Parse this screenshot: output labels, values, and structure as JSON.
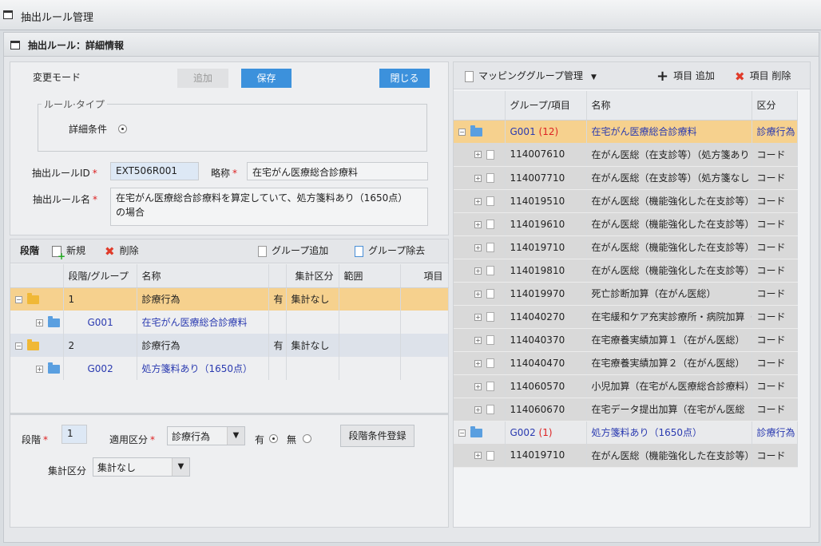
{
  "window": {
    "title": "抽出ルール管理"
  },
  "panel": {
    "title": "抽出ルール：詳細情報"
  },
  "form": {
    "mode_label": "変更モード",
    "add_label": "追加",
    "save_label": "保存",
    "close_label": "閉じる",
    "rule_type_legend": "ルール·タイプ",
    "detail_condition_label": "詳細条件",
    "rule_id_label": "抽出ルールID",
    "rule_id_value": "EXT506R001",
    "abbrev_label": "略称",
    "abbrev_value": "在宅がん医療総合診療料",
    "rule_name_label": "抽出ルール名",
    "rule_name_value": "在宅がん医療総合診療料を算定していて、処方箋料あり（1650点）の場合",
    "required_mark": "*"
  },
  "stage_toolbar": {
    "title": "段階",
    "new_label": "新規",
    "delete_label": "削除",
    "group_add_label": "グループ追加",
    "group_remove_label": "グループ除去"
  },
  "stage_table": {
    "columns": [
      "段階/グループ",
      "名称",
      "",
      "集計区分",
      "範囲",
      "項目"
    ],
    "rows": [
      {
        "id": "1",
        "name": "診療行為",
        "flag": "有",
        "agg": "集計なし",
        "type": "stage",
        "toggle": "−"
      },
      {
        "id": "G001",
        "name": "在宅がん医療総合診療料",
        "flag": "",
        "agg": "",
        "type": "group",
        "toggle": "+"
      },
      {
        "id": "2",
        "name": "診療行為",
        "flag": "有",
        "agg": "集計なし",
        "type": "stage",
        "toggle": "−"
      },
      {
        "id": "G002",
        "name": "処方箋料あり（1650点）",
        "flag": "",
        "agg": "",
        "type": "group",
        "toggle": "+"
      }
    ]
  },
  "stage_form": {
    "stage_label": "段階",
    "stage_value": "1",
    "apply_label": "適用区分",
    "apply_value": "診療行為",
    "yes_label": "有",
    "no_label": "無",
    "register_label": "段階条件登録",
    "agg_label": "集計区分",
    "agg_value": "集計なし"
  },
  "mapping_toolbar": {
    "title": "マッピンググループ管理",
    "add_item_label": "項目 追加",
    "delete_item_label": "項目 削除"
  },
  "mapping_table": {
    "columns": [
      "グループ/項目",
      "名称",
      "区分"
    ],
    "groups": [
      {
        "id": "G001",
        "count": "(12)",
        "name": "在宅がん医療総合診療料",
        "kind": "診療行為",
        "items": [
          {
            "code": "114007610",
            "name": "在がん医総（在支診等）（処方箋あり",
            "kind": "コード"
          },
          {
            "code": "114007710",
            "name": "在がん医総（在支診等）（処方箋なし",
            "kind": "コード"
          },
          {
            "code": "114019510",
            "name": "在がん医総（機能強化した在支診等）",
            "kind": "コード"
          },
          {
            "code": "114019610",
            "name": "在がん医総（機能強化した在支診等）",
            "kind": "コード"
          },
          {
            "code": "114019710",
            "name": "在がん医総（機能強化した在支診等）",
            "kind": "コード"
          },
          {
            "code": "114019810",
            "name": "在がん医総（機能強化した在支診等）",
            "kind": "コード"
          },
          {
            "code": "114019970",
            "name": "死亡診断加算（在がん医総）",
            "kind": "コード"
          },
          {
            "code": "114040270",
            "name": "在宅緩和ケア充実診療所・病院加算（",
            "kind": "コード"
          },
          {
            "code": "114040370",
            "name": "在宅療養実績加算１（在がん医総）",
            "kind": "コード"
          },
          {
            "code": "114040470",
            "name": "在宅療養実績加算２（在がん医総）",
            "kind": "コード"
          },
          {
            "code": "114060570",
            "name": "小児加算（在宅がん医療総合診療料）",
            "kind": "コード"
          },
          {
            "code": "114060670",
            "name": "在宅データ提出加算（在宅がん医総",
            "kind": "コード"
          }
        ]
      },
      {
        "id": "G002",
        "count": "(1)",
        "name": "処方箋料あり（1650点）",
        "kind": "診療行為",
        "items": [
          {
            "code": "114019710",
            "name": "在がん医総（機能強化した在支診等）",
            "kind": "コード"
          }
        ]
      }
    ]
  }
}
